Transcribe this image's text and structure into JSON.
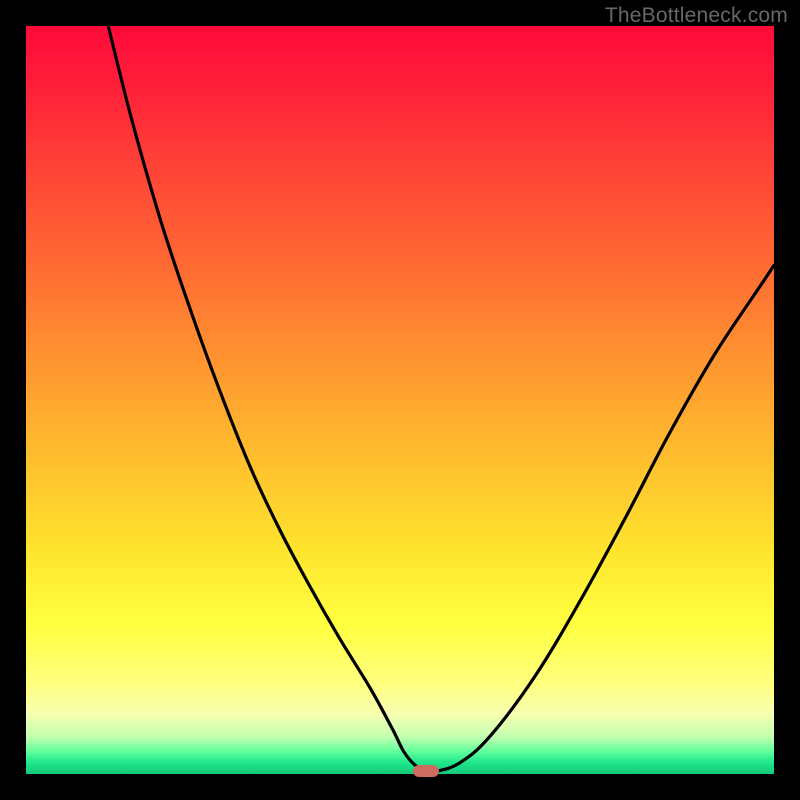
{
  "watermark": {
    "text": "TheBottleneck.com"
  },
  "colors": {
    "frame": "#000000",
    "curve_stroke": "#000000",
    "marker_fill": "#cc6b60",
    "watermark_text": "#676767"
  },
  "chart_data": {
    "type": "line",
    "title": "",
    "xlabel": "",
    "ylabel": "",
    "xlim": [
      0,
      100
    ],
    "ylim": [
      0,
      100
    ],
    "grid": false,
    "series": [
      {
        "name": "bottleneck-curve",
        "x": [
          11,
          14,
          18,
          22,
          26,
          30,
          34,
          38,
          42,
          46,
          49,
          50.5,
          52,
          53.5,
          55,
          58,
          62,
          68,
          74,
          80,
          86,
          92,
          98,
          100
        ],
        "y": [
          100,
          88,
          74,
          62,
          51,
          41,
          32.5,
          25,
          18,
          11.5,
          6,
          3,
          1.2,
          0.4,
          0.4,
          1.5,
          5,
          13,
          23,
          34,
          45.5,
          56,
          65,
          68
        ]
      }
    ],
    "marker": {
      "x_pct": 53.5,
      "y_pct": 0.4,
      "shape": "rounded-rect"
    },
    "background_gradient": "red-yellow-green (top→bottom)"
  }
}
